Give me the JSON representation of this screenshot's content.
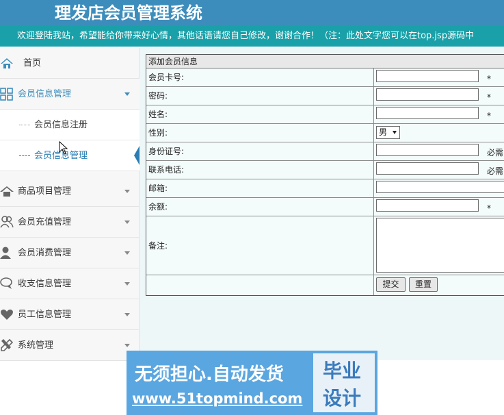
{
  "header": {
    "title": "理发店会员管理系统",
    "marquee": "欢迎登陆我站，希望能给你带来好心情，其他话语请您自己修改，谢谢合作！（注：此处文字您可以在top.jsp源码中"
  },
  "sidebar": {
    "home": "首页",
    "member_group": "会员信息管理",
    "sub_register": "会员信息注册",
    "sub_manage": "会员信息管理",
    "items": [
      "商品项目管理",
      "会员充值管理",
      "会员消费管理",
      "收支信息管理",
      "员工信息管理",
      "系统管理"
    ]
  },
  "form": {
    "title": "添加会员信息",
    "card_label": "会员卡号:",
    "password_label": "密码:",
    "name_label": "姓名:",
    "gender_label": "性别:",
    "gender_value": "男",
    "id_label": "身份证号:",
    "phone_label": "联系电话:",
    "email_label": "邮箱:",
    "balance_label": "余额:",
    "remark_label": "备注:",
    "star": "*",
    "required_text": "必需",
    "submit": "提交",
    "reset": "重置"
  },
  "watermark": {
    "line1": "无须担心.自动发货",
    "line2": "www.51topmind.com",
    "badge1": "毕业",
    "badge2": "设计"
  },
  "colors": {
    "header": "#3c8dbc",
    "marquee": "#1aa0a8",
    "accent": "#2b7db3"
  }
}
